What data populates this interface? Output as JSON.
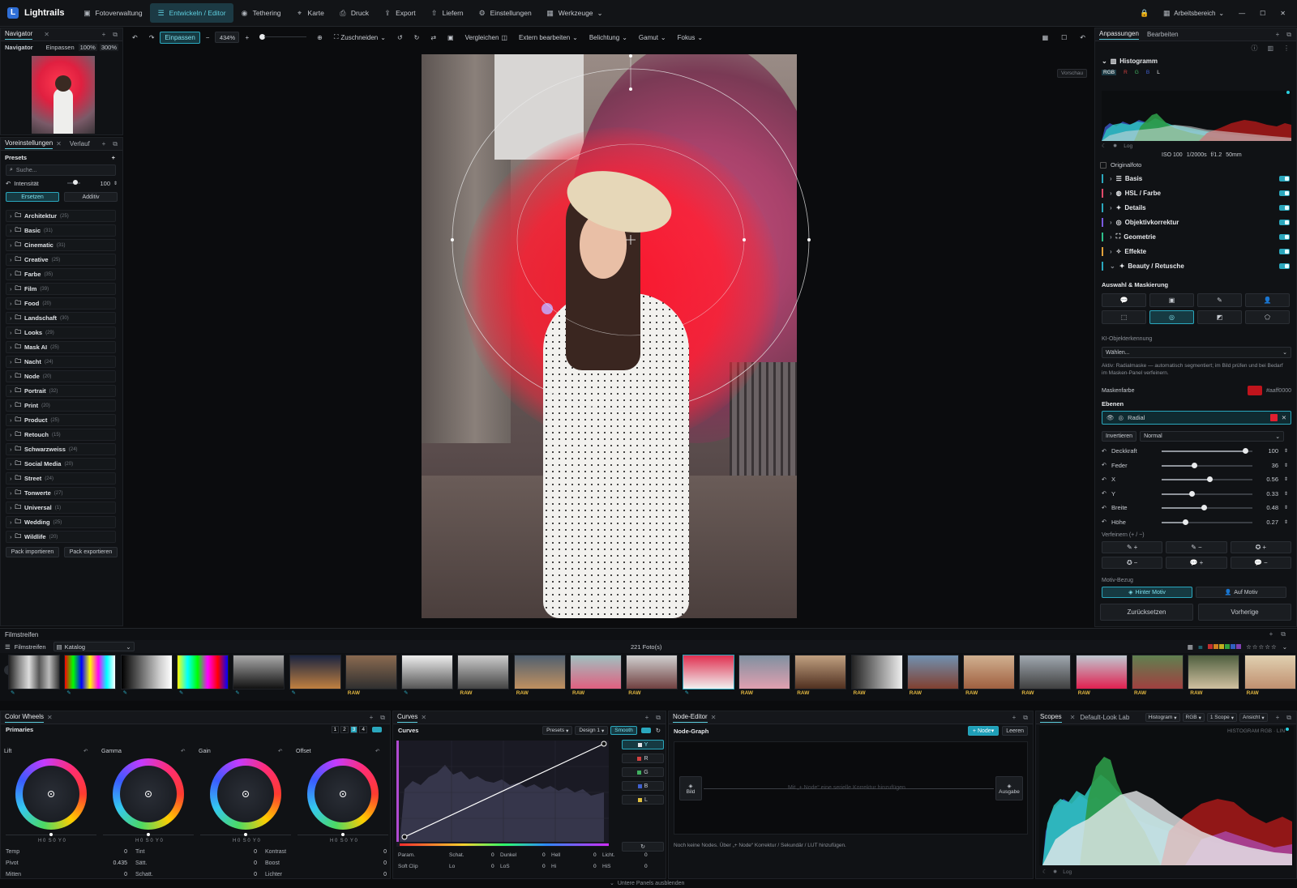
{
  "app": {
    "name": "Lightrails"
  },
  "topnav": [
    {
      "label": "Fotoverwaltung",
      "icon": "photos-icon"
    },
    {
      "label": "Entwickeln / Editor",
      "icon": "sliders-icon",
      "active": true
    },
    {
      "label": "Tethering",
      "icon": "camera-icon"
    },
    {
      "label": "Karte",
      "icon": "map-pin-icon"
    },
    {
      "label": "Druck",
      "icon": "printer-icon"
    },
    {
      "label": "Export",
      "icon": "export-icon"
    },
    {
      "label": "Liefern",
      "icon": "upload-icon"
    },
    {
      "label": "Einstellungen",
      "icon": "gear-icon"
    },
    {
      "label": "Werkzeuge",
      "icon": "grid-icon"
    }
  ],
  "workspace": {
    "label": "Arbeitsbereich"
  },
  "navigator": {
    "tab": "Navigator",
    "title": "Navigator",
    "fit": "Einpassen",
    "zoom100": "100%",
    "zoom300": "300%"
  },
  "presets_panel": {
    "tab_presets": "Voreinstellungen",
    "tab_history": "Verlauf",
    "title": "Presets",
    "search_placeholder": "Suche...",
    "intensity_label": "Intensität",
    "intensity_value": "100",
    "intensity_level": 0.6,
    "mode_replace": "Ersetzen",
    "mode_add": "Additiv",
    "items": [
      {
        "name": "Architektur",
        "count": "(25)"
      },
      {
        "name": "Basic",
        "count": "(31)"
      },
      {
        "name": "Cinematic",
        "count": "(31)"
      },
      {
        "name": "Creative",
        "count": "(25)"
      },
      {
        "name": "Farbe",
        "count": "(35)"
      },
      {
        "name": "Film",
        "count": "(39)"
      },
      {
        "name": "Food",
        "count": "(20)"
      },
      {
        "name": "Landschaft",
        "count": "(30)"
      },
      {
        "name": "Looks",
        "count": "(29)"
      },
      {
        "name": "Mask AI",
        "count": "(25)"
      },
      {
        "name": "Nacht",
        "count": "(24)"
      },
      {
        "name": "Node",
        "count": "(20)"
      },
      {
        "name": "Portrait",
        "count": "(32)"
      },
      {
        "name": "Print",
        "count": "(20)"
      },
      {
        "name": "Product",
        "count": "(25)"
      },
      {
        "name": "Retouch",
        "count": "(15)"
      },
      {
        "name": "Schwarzweiss",
        "count": "(24)"
      },
      {
        "name": "Social Media",
        "count": "(20)"
      },
      {
        "name": "Street",
        "count": "(24)"
      },
      {
        "name": "Tonwerte",
        "count": "(27)"
      },
      {
        "name": "Universal",
        "count": "(1)"
      },
      {
        "name": "Wedding",
        "count": "(25)"
      },
      {
        "name": "Wildlife",
        "count": "(20)"
      }
    ],
    "import_label": "Pack importieren",
    "export_label": "Pack exportieren"
  },
  "toolbar": {
    "fit": "Einpassen",
    "zoom": "434%",
    "crop": "Zuschneiden",
    "compare": "Vergleichen",
    "external": "Extern bearbeiten",
    "exposure": "Belichtung",
    "gamut": "Gamut",
    "focus": "Fokus",
    "preview": "Vorschau"
  },
  "right_panel": {
    "tab_adjust": "Anpassungen",
    "tab_edit": "Bearbeiten",
    "histogram_title": "Histogramm",
    "channels": [
      "RGB",
      "R",
      "G",
      "B",
      "L"
    ],
    "log": "Log",
    "exif": {
      "iso": "ISO 100",
      "shutter": "1/2000s",
      "aperture": "f/1.2",
      "focal": "50mm"
    },
    "original": "Originalfoto",
    "sections": [
      {
        "label": "Basis",
        "color": "#2aa7bd",
        "icon": "sliders-icon"
      },
      {
        "label": "HSL / Farbe",
        "color": "#e04a6a",
        "icon": "drop-icon"
      },
      {
        "label": "Details",
        "color": "#2aa7bd",
        "icon": "sparkle-icon"
      },
      {
        "label": "Objektivkorrektur",
        "color": "#7a5ae0",
        "icon": "lens-icon"
      },
      {
        "label": "Geometrie",
        "color": "#2ec08a",
        "icon": "crop-icon"
      },
      {
        "label": "Effekte",
        "color": "#e0a03a",
        "icon": "magic-icon"
      },
      {
        "label": "Beauty / Retusche",
        "color": "#2aa7bd",
        "icon": "sparkle-icon"
      }
    ],
    "mask_title": "Auswahl & Maskierung",
    "ai_label": "KI-Objekterkennung",
    "ai_select": "Wählen...",
    "active_note": "Aktiv: Radialmaske — automatisch segmentiert; im Bild prüfen und bei Bedarf im Masken-Panel verfeinern.",
    "mask_color_label": "Maskenfarbe",
    "mask_color_value": "#aaff0000",
    "mask_color": "#c0141c",
    "layers_label": "Ebenen",
    "layer_name": "Radial",
    "invert": "Invertieren",
    "blend": "Normal",
    "sliders": [
      {
        "label": "Deckkraft",
        "value": "100",
        "level": 0.92
      },
      {
        "label": "Feder",
        "value": "36",
        "level": 0.36
      },
      {
        "label": "X",
        "value": "0.56",
        "level": 0.53
      },
      {
        "label": "Y",
        "value": "0.33",
        "level": 0.33
      },
      {
        "label": "Breite",
        "value": "0.48",
        "level": 0.46
      },
      {
        "label": "Höhe",
        "value": "0.27",
        "level": 0.26
      }
    ],
    "refine_label": "Verfeinern (+ / −)",
    "refine_buttons": [
      "+",
      "−",
      "+",
      "−",
      "+",
      "−"
    ],
    "motif_label": "Motiv-Bezug",
    "behind": "Hinter Motiv",
    "on": "Auf Motiv",
    "reset": "Zurücksetzen",
    "previous": "Vorherige"
  },
  "filmstrip": {
    "title": "Filmstreifen",
    "tab": "Filmstreifen",
    "catalog": "Katalog",
    "count": "221 Foto(s)",
    "raw": "RAW"
  },
  "color_wheels": {
    "tab": "Color Wheels",
    "title": "Primaries",
    "pages": [
      "1",
      "2",
      "3",
      "4"
    ],
    "wheels": [
      {
        "label": "Lift",
        "vals": "H 0  S 0  Y 0"
      },
      {
        "label": "Gamma",
        "vals": "H 0  S 0  Y 0"
      },
      {
        "label": "Gain",
        "vals": "H 0  S 0  Y 0"
      },
      {
        "label": "Offset",
        "vals": "H 0  S 0  Y 0"
      }
    ],
    "params": [
      [
        {
          "l": "Temp",
          "v": "0"
        },
        {
          "l": "Tint",
          "v": "0"
        },
        {
          "l": "Kontrast",
          "v": "0"
        }
      ],
      [
        {
          "l": "Pivot",
          "v": "0.435"
        },
        {
          "l": "Sätt.",
          "v": "0"
        },
        {
          "l": "Boost",
          "v": "0"
        }
      ],
      [
        {
          "l": "Mitten",
          "v": "0"
        },
        {
          "l": "Schatt.",
          "v": "0"
        },
        {
          "l": "Lichter",
          "v": "0"
        }
      ]
    ]
  },
  "curves": {
    "tab": "Curves",
    "title": "Curves",
    "presets": "Presets",
    "design": "Design 1",
    "smooth": "Smooth",
    "channels": [
      "Y",
      "R",
      "G",
      "B",
      "L"
    ],
    "params": [
      [
        {
          "l": "Param.",
          "v": ""
        },
        {
          "l": "Schat.",
          "v": "0"
        },
        {
          "l": "Dunkel",
          "v": "0"
        },
        {
          "l": "Hell",
          "v": "0"
        },
        {
          "l": "Licht.",
          "v": "0"
        }
      ],
      [
        {
          "l": "Soft Clip",
          "v": ""
        },
        {
          "l": "Lo",
          "v": "0"
        },
        {
          "l": "LoS",
          "v": "0"
        },
        {
          "l": "Hi",
          "v": "0"
        },
        {
          "l": "HiS",
          "v": "0"
        }
      ]
    ]
  },
  "node_editor": {
    "tab": "Node-Editor",
    "title": "Node-Graph",
    "add": "+ Node",
    "clear": "Leeren",
    "input": "Bild",
    "output": "Ausgabe",
    "hint": "Mit „+ Node“ eine serielle Korrektur hinzufügen",
    "status": "Noch keine Nodes. Über „+ Node“ Korrektur / Sekundär / LUT hinzufügen."
  },
  "scopes": {
    "tab": "Scopes",
    "tab2": "Default-Look Lab",
    "mode": "Histogram",
    "space": "RGB",
    "scope": "1 Scope",
    "view": "Ansicht",
    "label": "HISTOGRAM RGB · LIN",
    "log": "Log"
  },
  "footer": {
    "hide": "Untere Panels ausblenden"
  }
}
